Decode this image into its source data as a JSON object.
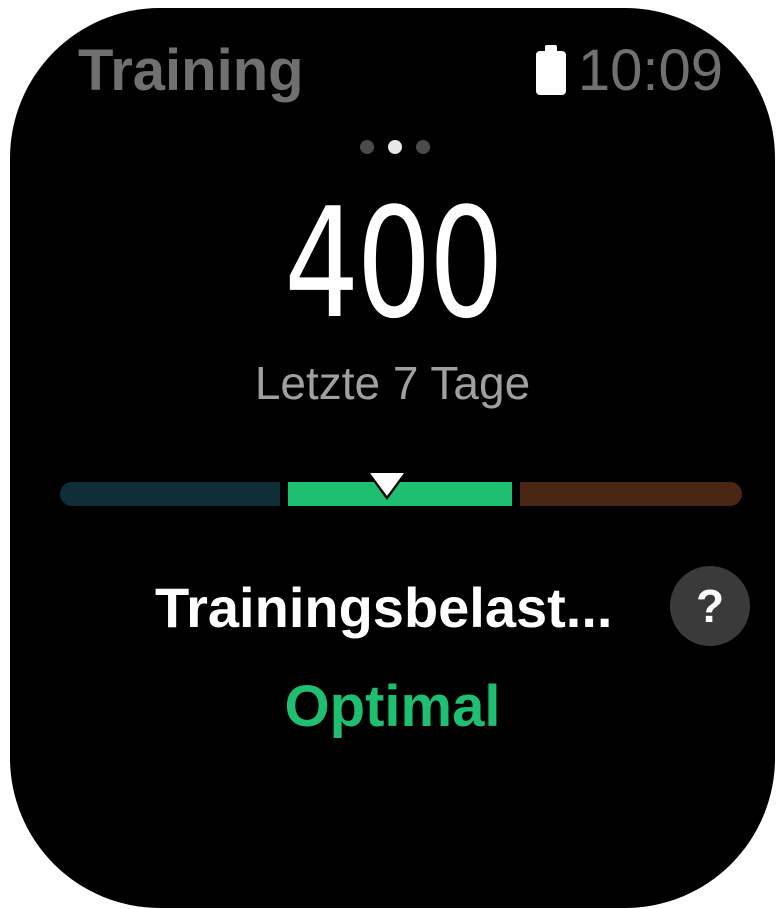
{
  "header": {
    "title": "Training",
    "time": "10:09",
    "battery_icon": "battery-full-icon"
  },
  "pager": {
    "pages": 3,
    "active_index": 1
  },
  "metric": {
    "value": "400",
    "period": "Letzte 7 Tage",
    "label": "Trainingsbelast...",
    "status": "Optimal",
    "help_label": "?"
  },
  "scale": {
    "segments": [
      "low",
      "optimal",
      "high"
    ],
    "marker_fraction": 0.48
  },
  "colors": {
    "background": "#000000",
    "accent": "#1fbf72",
    "segment_low": "#0f2e38",
    "segment_optimal": "#1fbf72",
    "segment_high": "#4a2614",
    "muted_text": "#707070"
  }
}
